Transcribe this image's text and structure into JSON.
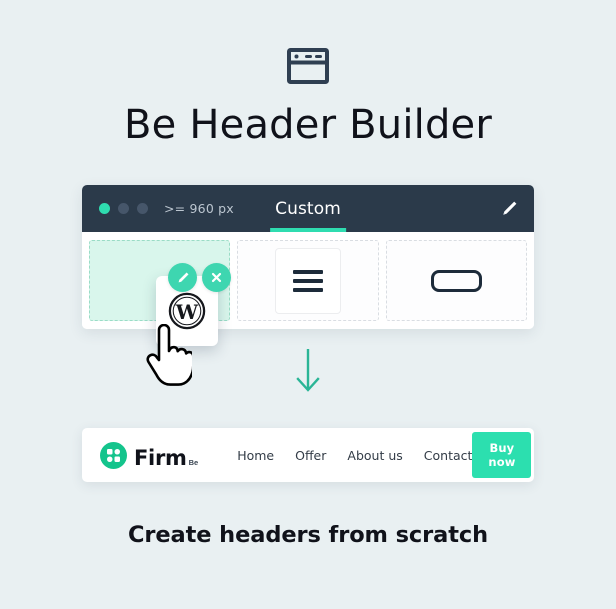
{
  "page": {
    "title": "Be Header Builder",
    "caption": "Create headers from scratch",
    "background_color": "#e9f0f2",
    "accent_color": "#2fdcb0",
    "dark_color": "#2b3a4a"
  },
  "promo_icon": {
    "name": "browser-window-icon"
  },
  "builder": {
    "toolbar": {
      "dots": [
        {
          "name": "dot-active",
          "color": "#2fdcb0"
        },
        {
          "name": "dot-inactive-1",
          "color": "#46566a"
        },
        {
          "name": "dot-inactive-2",
          "color": "#46566a"
        }
      ],
      "breakpoint_label": ">= 960 px",
      "tab_label": "Custom",
      "edit_icon": "pencil-icon"
    },
    "zones": [
      {
        "name": "logo-drop-zone",
        "state": "active",
        "content": "wordpress-logo-card"
      },
      {
        "name": "menu-drop-zone",
        "state": "filled",
        "content": "hamburger-menu"
      },
      {
        "name": "button-drop-zone",
        "state": "filled",
        "content": "button-placeholder"
      }
    ],
    "zone_actions": [
      {
        "name": "edit-element-button",
        "icon": "pencil-icon"
      },
      {
        "name": "remove-element-button",
        "icon": "close-icon"
      }
    ],
    "dragged_item": {
      "name": "wordpress-logo-card",
      "icon": "wordpress-icon"
    },
    "cursor": {
      "name": "hand-pointer-cursor"
    }
  },
  "arrow": {
    "name": "arrow-down-icon",
    "color": "#2ab596"
  },
  "preview_header": {
    "brand": {
      "name": "Firm",
      "suffix": "Be",
      "mark": "four-dots-logo-icon"
    },
    "nav_links": [
      {
        "label": "Home"
      },
      {
        "label": "Offer"
      },
      {
        "label": "About us"
      },
      {
        "label": "Contact"
      }
    ],
    "cta": {
      "label": "Buy now",
      "color": "#2cdfaf"
    }
  }
}
